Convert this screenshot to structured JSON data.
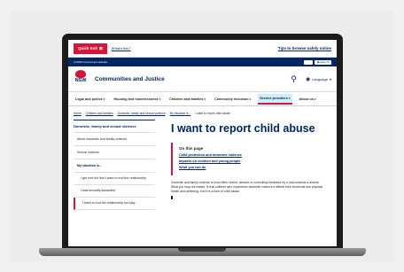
{
  "topbar": {
    "quick_exit": "Quick Exit",
    "quick_exit_icon": "close-x-icon",
    "whats_this": "What's this?",
    "safe_link": "Tips to browse safely online"
  },
  "govbar": {
    "text": "A NSW Government website",
    "buttons": [
      "",
      "Listen"
    ]
  },
  "masthead": {
    "logo_text": "NSW",
    "brand": "Communities and Justice",
    "language": "Language"
  },
  "nav": [
    {
      "label": "Legal and justice"
    },
    {
      "label": "Housing and homelessness"
    },
    {
      "label": "Children and families"
    },
    {
      "label": "Community inclusion"
    },
    {
      "label": "Service providers"
    },
    {
      "label": "About us"
    }
  ],
  "breadcrumbs": [
    "Home",
    "Children and families",
    "Domestic, family and sexual violence",
    "My situation is...",
    "I want to report child abuse"
  ],
  "sidenav": {
    "heading": "Domestic, family and sexual violence",
    "items": [
      "About domestic and family violence",
      "Sexual violence",
      "My situation is..."
    ],
    "sub_items": [
      "I get hurt but don't want to end the relationship",
      "I was sexually assaulted",
      "I want to end the relationship but stay"
    ]
  },
  "main": {
    "title": "I want to report child abuse",
    "on_this_page": "On this page",
    "links": [
      "Child protection and domestic violence",
      "Impacts on children and young people",
      "What you can do"
    ],
    "paragraph": "Domestic and family violence is most often violent, abusive or controlling behaviour by a man towards a woman. What you may not realise, is that children who experience domestic violence it affects their emotional and physical health and wellbeing. And it is a form of child abuse."
  },
  "colors": {
    "navy": "#002664",
    "red": "#d7153a",
    "highlight": "#cbedfd"
  }
}
